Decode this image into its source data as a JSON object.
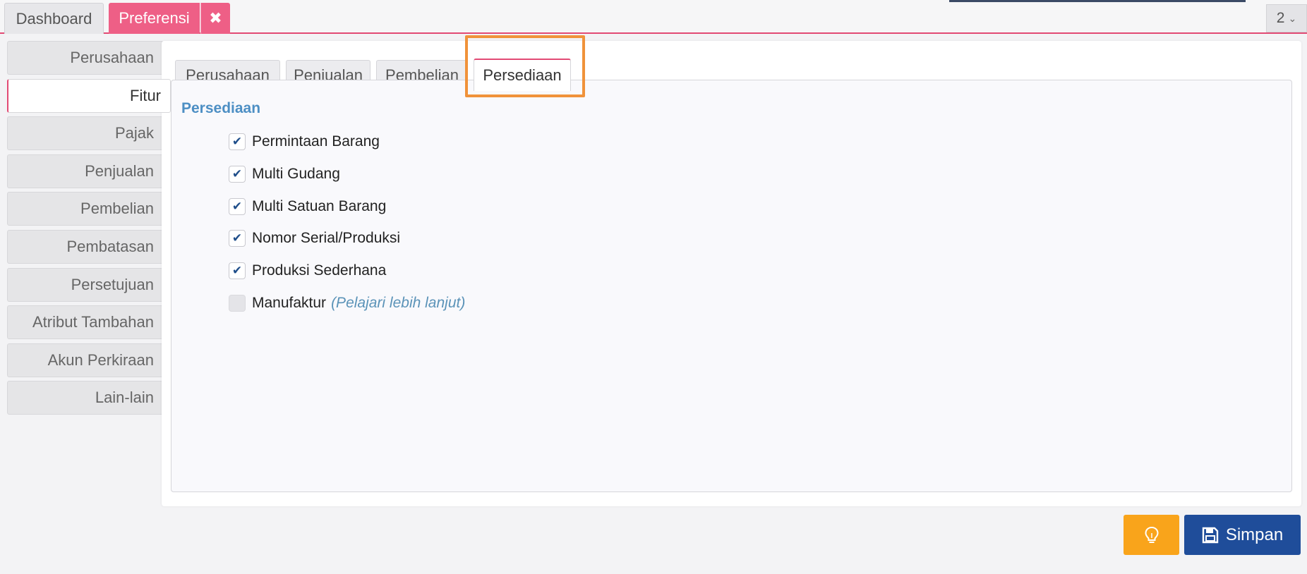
{
  "top_tabs": {
    "dashboard": "Dashboard",
    "preferensi": "Preferensi",
    "close_glyph": "✖",
    "counter": "2",
    "counter_chevron": "⌄"
  },
  "sidebar": {
    "items": [
      {
        "label": "Perusahaan"
      },
      {
        "label": "Fitur",
        "active": true
      },
      {
        "label": "Pajak"
      },
      {
        "label": "Penjualan"
      },
      {
        "label": "Pembelian"
      },
      {
        "label": "Pembatasan"
      },
      {
        "label": "Persetujuan"
      },
      {
        "label": "Atribut Tambahan"
      },
      {
        "label": "Akun Perkiraan"
      },
      {
        "label": "Lain-lain"
      }
    ]
  },
  "inner_tabs": {
    "items": [
      {
        "label": "Perusahaan"
      },
      {
        "label": "Penjualan"
      },
      {
        "label": "Pembelian"
      },
      {
        "label": "Persediaan",
        "active": true
      }
    ]
  },
  "section": {
    "title": "Persediaan",
    "options": [
      {
        "label": "Permintaan Barang",
        "checked": true,
        "glyph": "✔"
      },
      {
        "label": "Multi Gudang",
        "checked": true,
        "glyph": "✔"
      },
      {
        "label": "Multi Satuan Barang",
        "checked": true,
        "glyph": "✔"
      },
      {
        "label": "Nomor Serial/Produksi",
        "checked": true,
        "glyph": "✔"
      },
      {
        "label": "Produksi Sederhana",
        "checked": true,
        "glyph": "✔"
      },
      {
        "label": "Manufaktur",
        "checked": false,
        "glyph": "",
        "link": "(Pelajari lebih lanjut)"
      }
    ]
  },
  "footer": {
    "hint_icon": "lightbulb-icon",
    "save_label": "Simpan",
    "save_icon": "floppy-disk-icon"
  },
  "colors": {
    "accent_pink": "#ee5f86",
    "highlight_orange": "#f0923a",
    "section_blue": "#4d8fc4",
    "save_button": "#1f4d9a",
    "hint_button": "#f9a41b"
  }
}
